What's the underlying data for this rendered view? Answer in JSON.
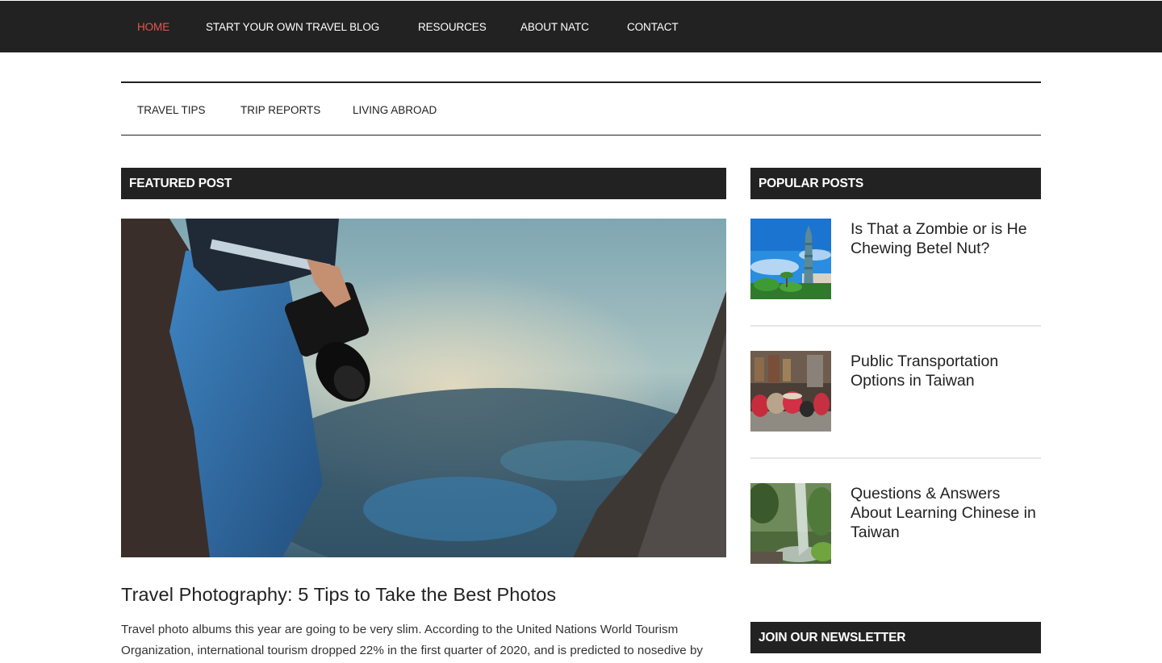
{
  "top_nav": {
    "items": [
      {
        "label": "HOME"
      },
      {
        "label": "START YOUR OWN TRAVEL BLOG"
      },
      {
        "label": "RESOURCES"
      },
      {
        "label": "ABOUT NATC"
      },
      {
        "label": "CONTACT"
      }
    ],
    "active_color": "#e8554e"
  },
  "secondary_nav": {
    "items": [
      {
        "label": "TRAVEL TIPS"
      },
      {
        "label": "TRIP REPORTS"
      },
      {
        "label": "LIVING ABROAD"
      }
    ]
  },
  "featured": {
    "heading": "FEATURED POST",
    "post_title": "Travel Photography: 5 Tips to Take the Best Photos",
    "excerpt": "Travel photo albums this year are going to be very slim. According to the United Nations World Tourism Organization, international tourism dropped 22% in the first quarter of 2020, and is predicted to nosedive by"
  },
  "popular": {
    "heading": "POPULAR POSTS",
    "posts": [
      {
        "title": "Is That a Zombie or is He Chewing Betel Nut?"
      },
      {
        "title": "Public Transportation Options in Taiwan"
      },
      {
        "title": "Questions & Answers About Learning Chinese in Taiwan"
      }
    ]
  },
  "newsletter": {
    "heading": "JOIN OUR NEWSLETTER"
  },
  "colors": {
    "dark_bar": "#222222",
    "accent": "#e8554e"
  }
}
